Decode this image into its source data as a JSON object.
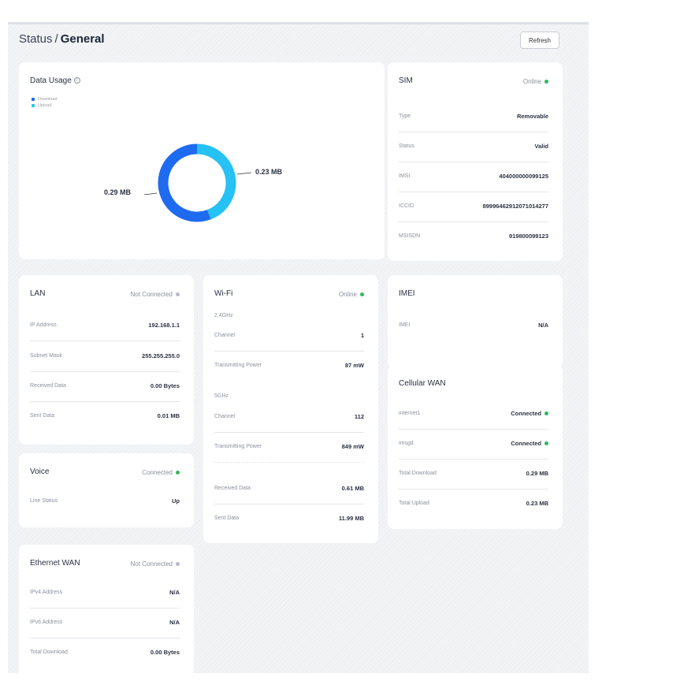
{
  "header": {
    "crumb": "Status",
    "separator": "/",
    "current": "General",
    "refresh_label": "Refresh"
  },
  "colors": {
    "download": "#1e6bf0",
    "upload": "#26c1f5",
    "online": "#2dbb5d",
    "offline": "#b6bac2"
  },
  "data_usage": {
    "title": "Data Usage",
    "legend": {
      "download": "Download",
      "upload": "Upload"
    },
    "download_label": "0.29 MB",
    "upload_label": "0.23 MB",
    "download_value": 0.29,
    "upload_value": 0.23
  },
  "sim": {
    "title": "SIM",
    "status": "Online",
    "rows": [
      {
        "label": "Type",
        "value": "Removable"
      },
      {
        "label": "Status",
        "value": "Valid"
      },
      {
        "label": "IMSI",
        "value": "404000000099125"
      },
      {
        "label": "ICCID",
        "value": "89996462912071014277"
      },
      {
        "label": "MSISDN",
        "value": "919800099123"
      }
    ]
  },
  "lan": {
    "title": "LAN",
    "status": "Not Connected",
    "rows": [
      {
        "label": "IP Address",
        "value": "192.168.1.1"
      },
      {
        "label": "Subnet Mask",
        "value": "255.255.255.0"
      },
      {
        "label": "Received Data",
        "value": "0.00 Bytes"
      },
      {
        "label": "Sent Data",
        "value": "0.01 MB"
      }
    ]
  },
  "wifi": {
    "title": "Wi-Fi",
    "status": "Online",
    "band1": {
      "name": "2.4GHz",
      "channel_label": "Channel",
      "channel": "1",
      "power_label": "Transmitting Power",
      "power": "87 mW"
    },
    "band2": {
      "name": "5GHz",
      "channel_label": "Channel",
      "channel": "112",
      "power_label": "Transmitting Power",
      "power": "849 mW"
    },
    "received_label": "Received Data",
    "received": "0.61 MB",
    "sent_label": "Sent Data",
    "sent": "11.99 MB"
  },
  "imei": {
    "title": "IMEI",
    "label": "IMEI",
    "value": "N/A"
  },
  "cellular_wan": {
    "title": "Cellular WAN",
    "rows": [
      {
        "label": "internet1",
        "value": "Connected"
      },
      {
        "label": "imsgd",
        "value": "Connected"
      },
      {
        "label": "Total Download",
        "value": "0.29 MB"
      },
      {
        "label": "Total Upload",
        "value": "0.23 MB"
      }
    ]
  },
  "voice": {
    "title": "Voice",
    "status": "Connected",
    "rows": [
      {
        "label": "Line Status",
        "value": "Up"
      }
    ]
  },
  "ethernet_wan": {
    "title": "Ethernet WAN",
    "status": "Not Connected",
    "rows": [
      {
        "label": "IPv4 Address",
        "value": "N/A"
      },
      {
        "label": "IPv6 Address",
        "value": "N/A"
      },
      {
        "label": "Total Download",
        "value": "0.00 Bytes"
      }
    ]
  }
}
